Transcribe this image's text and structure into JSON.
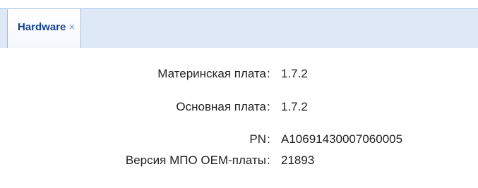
{
  "tabs": [
    {
      "label": "Hardware",
      "close": "×"
    }
  ],
  "hardware": {
    "rows": [
      {
        "label": "Материнская плата",
        "value": "1.7.2"
      },
      {
        "label": "Основная плата",
        "value": "1.7.2"
      },
      {
        "label": "PN",
        "value": "A10691430007060005"
      },
      {
        "label": "Версия МПО OEM-платы",
        "value": "21893"
      }
    ]
  },
  "colors": {
    "tab_text": "#15428b",
    "tab_border": "#99bbe8",
    "tab_strip": "#dfe8f6",
    "body_text": "#222222"
  }
}
